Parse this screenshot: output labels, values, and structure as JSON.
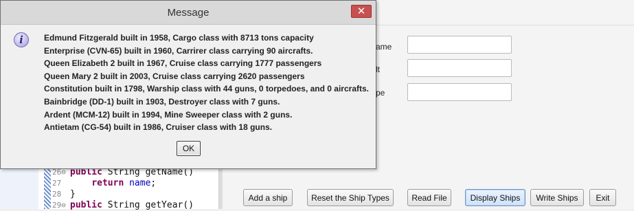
{
  "dialog": {
    "title": "Message",
    "close_glyph": "✕",
    "icon": "information-icon",
    "icon_glyph": "i",
    "lines": [
      "Edmund Fitzgerald built in 1958, Cargo class with 8713 tons capacity",
      "Enterprise (CVN-65) built in 1960, Carrirer class carrying 90 aircrafts.",
      "Queen Elizabeth 2 built in 1967, Cruise class carrying 1777 passengers",
      "Queen Mary 2 built in 2003, Cruise class carrying 2620 passengers",
      "Constitution built in 1798, Warship class with 44 guns, 0 torpedoes, and 0 aircrafts.",
      "Bainbridge (DD-1) built in 1903, Destroyer class with 7 guns.",
      "Ardent (MCM-12) built in 1994, Mine Sweeper class with 2 guns.",
      "Antietam (CG-54) built in 1986, Cruiser class with 18 guns."
    ],
    "ok_label": "OK"
  },
  "form": {
    "labels": [
      "ame",
      "lt",
      "pe"
    ],
    "fields": [
      "",
      "",
      ""
    ]
  },
  "buttons": [
    {
      "label": "Add a ship",
      "name": "add-ship-button"
    },
    {
      "label": "Reset the Ship Types",
      "name": "reset-ship-types-button"
    },
    {
      "label": "Read File",
      "name": "read-file-button"
    },
    {
      "label": "Display Ships",
      "name": "display-ships-button"
    },
    {
      "label": "Write Ships",
      "name": "write-ships-button"
    },
    {
      "label": "Exit",
      "name": "exit-button"
    }
  ],
  "ide": {
    "lines": [
      {
        "num": "26⊖",
        "code": "public String getName()"
      },
      {
        "num": "27",
        "code": "    return name;"
      },
      {
        "num": "28",
        "code": "}"
      },
      {
        "num": "29⊖",
        "code": "public String getYear()"
      }
    ]
  },
  "colors": {
    "close_button": "#c75050",
    "active_button": "#cfe2f8",
    "info_icon": "#b9b3e8"
  }
}
